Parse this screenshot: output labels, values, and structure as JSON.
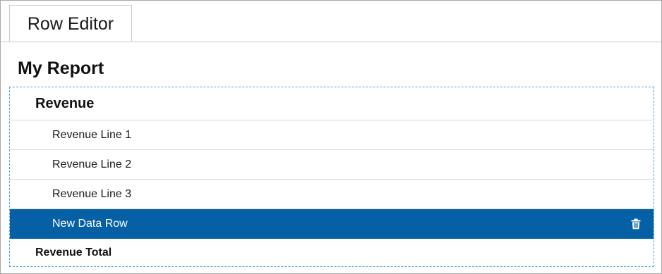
{
  "tabs": [
    {
      "label": "Row Editor",
      "active": true
    }
  ],
  "report": {
    "title": "My Report"
  },
  "rows": {
    "header": {
      "label": "Revenue"
    },
    "lines": [
      {
        "label": "Revenue Line 1"
      },
      {
        "label": "Revenue Line 2"
      },
      {
        "label": "Revenue Line 3"
      }
    ],
    "selected": {
      "label": "New Data Row",
      "icon": "trash-icon"
    },
    "total": {
      "label": "Revenue Total"
    }
  },
  "colors": {
    "selected_row_bg": "#0560a6",
    "selection_border": "#4aa3d8"
  }
}
